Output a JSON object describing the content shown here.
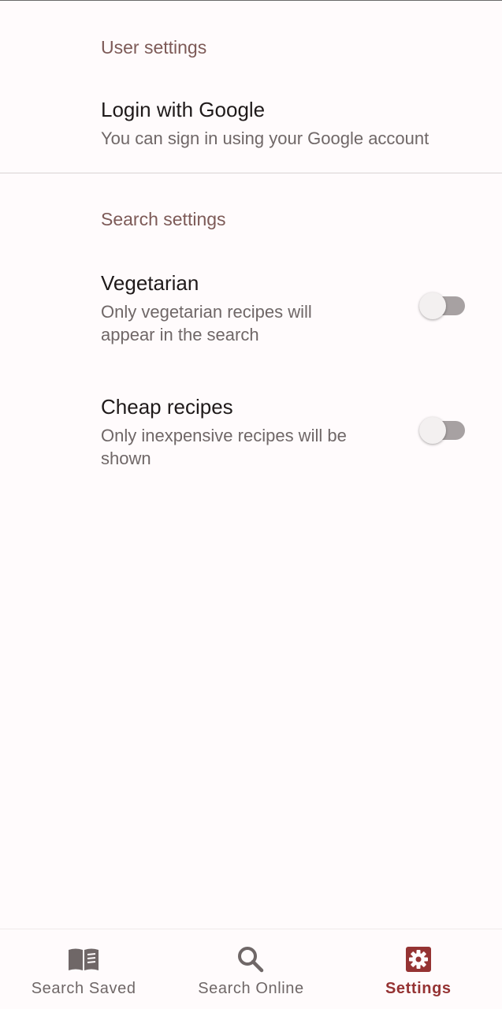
{
  "user_settings": {
    "header": "User settings",
    "login": {
      "title": "Login with Google",
      "summary": "You can sign in using your Google account"
    }
  },
  "search_settings": {
    "header": "Search settings",
    "vegetarian": {
      "title": "Vegetarian",
      "summary_line1": "Only vegetarian recipes will",
      "summary_line2": "appear in the search",
      "enabled": false
    },
    "cheap": {
      "title": "Cheap recipes",
      "summary_line1": "Only inexpensive recipes will be",
      "summary_line2": "shown",
      "enabled": false
    }
  },
  "bottom_nav": {
    "items": [
      {
        "label": "Search Saved",
        "icon": "book-icon",
        "active": false
      },
      {
        "label": "Search Online",
        "icon": "search-icon",
        "active": false
      },
      {
        "label": "Settings",
        "icon": "gear-icon",
        "active": true
      }
    ]
  },
  "colors": {
    "accent": "#953333",
    "section_header": "#7d5a57",
    "background": "#fffbfc",
    "switch_track_off": "#a7a1a2"
  }
}
